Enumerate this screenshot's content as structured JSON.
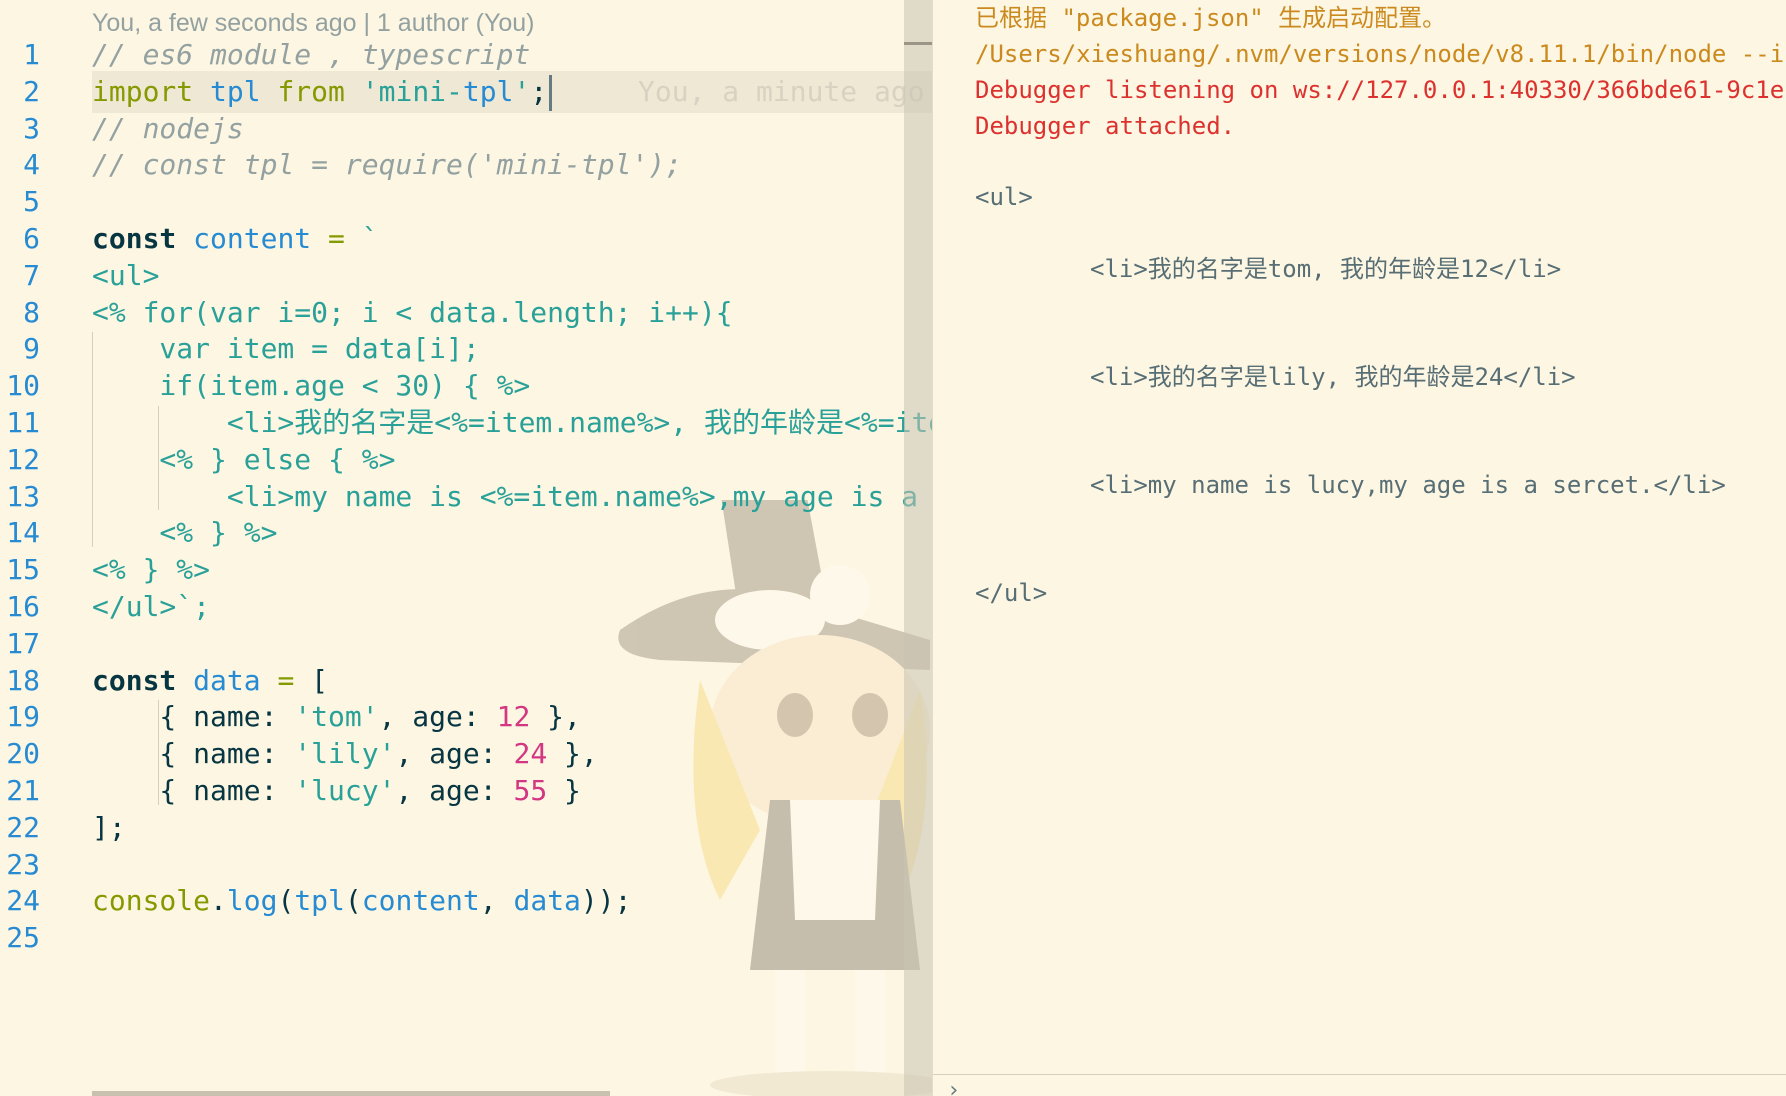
{
  "editor": {
    "codelens": "You, a few seconds ago | 1 author (You)",
    "blame_inline": "You, a minute ago",
    "line_numbers": [
      "1",
      "2",
      "3",
      "4",
      "5",
      "6",
      "7",
      "8",
      "9",
      "10",
      "11",
      "12",
      "13",
      "14",
      "15",
      "16",
      "17",
      "18",
      "19",
      "20",
      "21",
      "22",
      "23",
      "24",
      "25"
    ],
    "lines": [
      "// es6 module , typescript",
      "import tpl from 'mini-tpl';",
      "// nodejs",
      "// const tpl = require('mini-tpl');",
      "",
      "const content = `",
      "<ul>",
      "<% for(var i=0; i < data.length; i++){",
      "    var item = data[i];",
      "    if(item.age < 30) { %>",
      "        <li>我的名字是<%=item.name%>, 我的年龄是<%=ite",
      "    <% } else { %>",
      "        <li>my name is <%=item.name%>,my age is a",
      "    <% } %>",
      "<% } %>",
      "</ul>`;",
      "",
      "const data = [",
      "    { name: 'tom', age: 12 },",
      "    { name: 'lily', age: 24 },",
      "    { name: 'lucy', age: 55 }",
      "];",
      "",
      "console.log(tpl(content, data));",
      ""
    ]
  },
  "output": {
    "lines": [
      "已根据 \"package.json\" 生成启动配置。",
      "/Users/xieshuang/.nvm/versions/node/v8.11.1/bin/node --i",
      "Debugger listening on ws://127.0.0.1:40330/366bde61-9c1e-",
      "Debugger attached.",
      "<ul>",
      "<li>我的名字是tom, 我的年龄是12</li>",
      "<li>我的名字是lily, 我的年龄是24</li>",
      "<li>my name is lucy,my age is a sercet.</li>",
      "</ul>"
    ],
    "prompt": "›"
  },
  "colors": {
    "background": "#fdf6e3",
    "keyword": "#859900",
    "string": "#2aa198",
    "identifier": "#268bd2",
    "number": "#d33682",
    "comment": "#93a1a1",
    "error_text": "#dc322f",
    "info_text": "#cb8a1e"
  }
}
